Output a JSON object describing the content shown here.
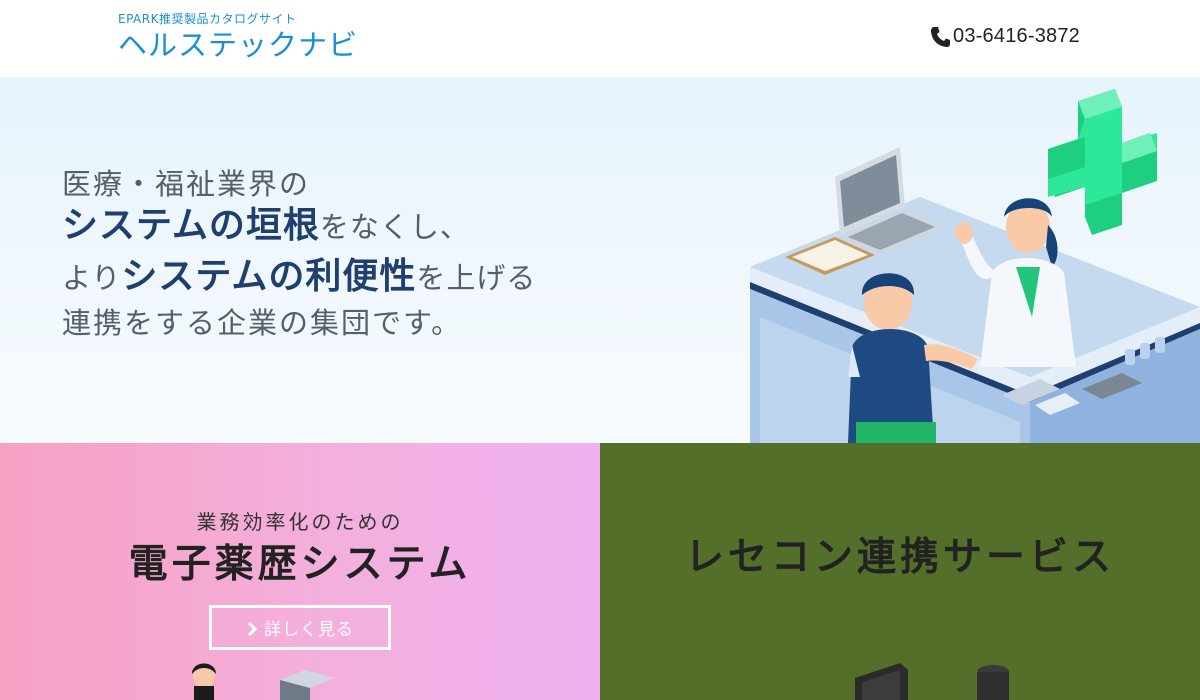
{
  "header": {
    "tagline": "EPARK推奨製品カタログサイト",
    "site_name": "ヘルステックナビ",
    "phone": "03-6416-3872"
  },
  "hero": {
    "line1": "医療・福祉業界の",
    "line2_em": "システムの垣根",
    "line2_rest": "をなくし、",
    "line3_pre": "より",
    "line3_em": "システムの利便性",
    "line3_rest": "を上げる",
    "line4": "連携をする企業の集団です。"
  },
  "panel_left": {
    "subtitle": "業務効率化のための",
    "title": "電子薬歴システム",
    "button_label": "詳しく見る"
  },
  "panel_right": {
    "title": "レセコン連携サービス"
  },
  "colors": {
    "brand_blue": "#1a8fd6",
    "hero_emphasis": "#1f3f6f",
    "panel_left_pink": "#f5a8d2",
    "panel_right_olive": "#536f2a",
    "cross_green": "#2ee89a"
  },
  "icons": {
    "phone": "phone-icon",
    "chevron": "chevron-right-icon"
  }
}
